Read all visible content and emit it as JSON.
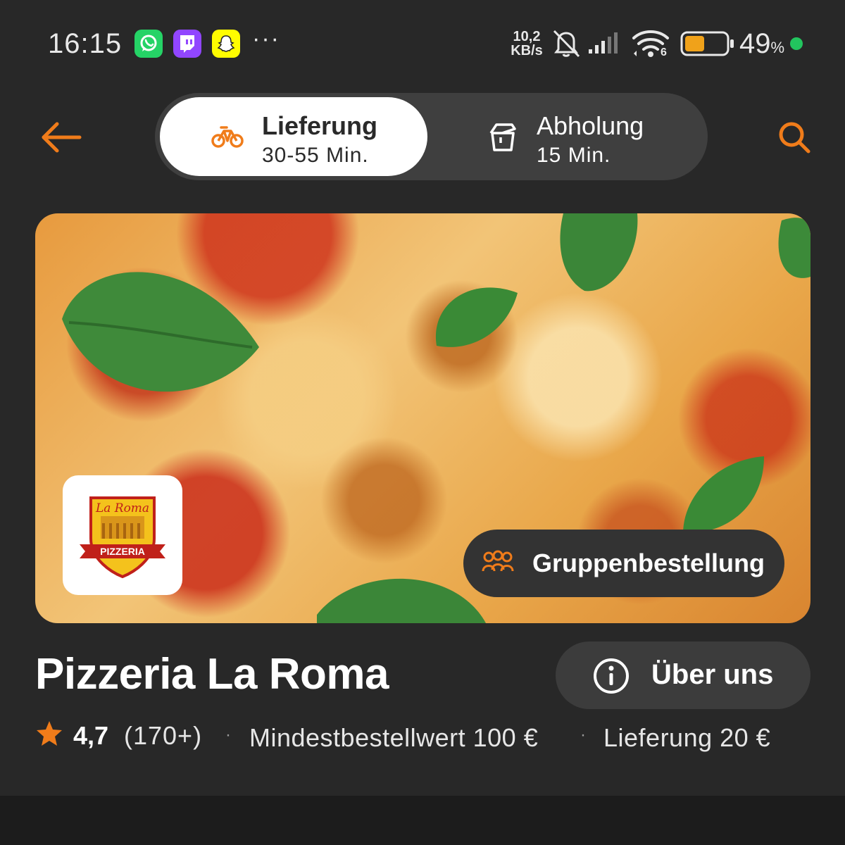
{
  "status_bar": {
    "time": "16:15",
    "net_speed_value": "10,2",
    "net_speed_unit": "KB/s",
    "wifi_badge": "6",
    "battery_percent": "49",
    "battery_unit": "%",
    "battery_level": 0.49,
    "more_indicator": "···",
    "apps": [
      "whatsapp-icon",
      "twitch-icon",
      "snapchat-icon"
    ]
  },
  "header": {
    "delivery_label": "Lieferung",
    "delivery_time": "30-55 Min.",
    "pickup_label": "Abholung",
    "pickup_time": "15 Min.",
    "accent_color": "#f07c1a"
  },
  "hero": {
    "group_order_label": "Gruppenbestellung",
    "logo_text_top": "La Roma",
    "logo_text_banner": "PIZZERIA"
  },
  "restaurant": {
    "name": "Pizzeria La Roma",
    "about_label": "Über uns",
    "rating": "4,7",
    "review_count": "(170+)",
    "separator": "·",
    "min_order": "Mindestbestellwert 100 €",
    "delivery_fee": "Lieferung 20 €"
  }
}
